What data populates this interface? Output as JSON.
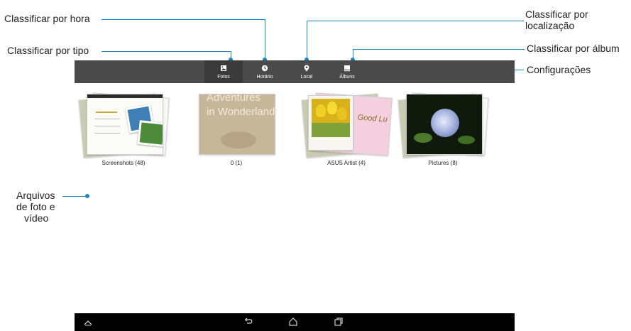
{
  "callouts": {
    "sort_by_time": "Classificar por hora",
    "sort_by_type": "Classificar por tipo",
    "sort_by_location_1": "Classificar por",
    "sort_by_location_2": "localização",
    "sort_by_album": "Classificar por álbum",
    "settings": "Configurações",
    "files_1": "Arquivos",
    "files_2": "de foto e",
    "files_3": "vídeo"
  },
  "tabs": [
    {
      "label": "Fotos",
      "icon": "photo-icon",
      "active": true
    },
    {
      "label": "Horário",
      "icon": "clock-icon",
      "active": false
    },
    {
      "label": "Local",
      "icon": "location-pin-icon",
      "active": false
    },
    {
      "label": "Álbuns",
      "icon": "album-icon",
      "active": false
    }
  ],
  "albums": [
    {
      "label": "Screenshots (48)",
      "thumb_text": ""
    },
    {
      "label": "0 (1)",
      "thumb_text_1": "Adventures",
      "thumb_text_2": "in Wonderland"
    },
    {
      "label": "ASUS Artist (4)",
      "thumb_text": "Good Lu"
    },
    {
      "label": "Pictures (8)",
      "thumb_text": ""
    }
  ],
  "colors": {
    "accent": "#1f86c7",
    "toolbar": "#4a4a4a",
    "navbar": "#000000"
  },
  "navbar_icons": [
    "up-icon",
    "back-icon",
    "home-icon",
    "recent-apps-icon"
  ]
}
